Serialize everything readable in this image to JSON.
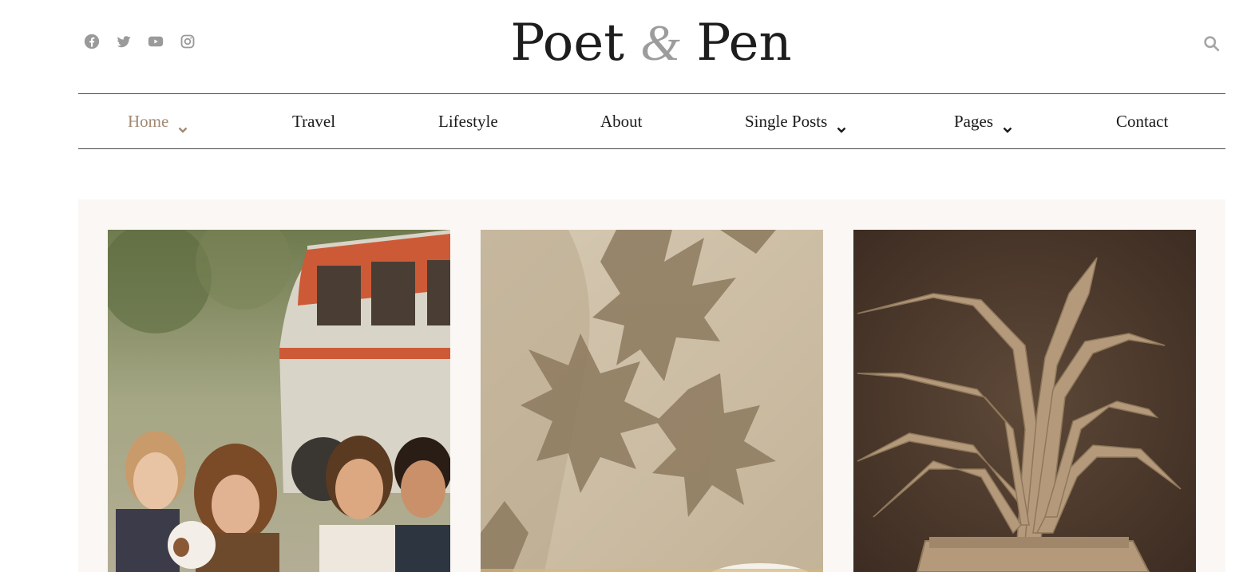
{
  "header": {
    "logo": {
      "part1": "Poet ",
      "amp": "&",
      "part2": " Pen"
    },
    "social": [
      "facebook-icon",
      "twitter-icon",
      "youtube-icon",
      "instagram-icon"
    ],
    "search_icon": "search-icon"
  },
  "nav": {
    "items": [
      {
        "label": "Home",
        "dropdown": true,
        "active": true
      },
      {
        "label": "Travel",
        "dropdown": false
      },
      {
        "label": "Lifestyle",
        "dropdown": false
      },
      {
        "label": "About",
        "dropdown": false
      },
      {
        "label": "Single Posts",
        "dropdown": true
      },
      {
        "label": "Pages",
        "dropdown": true
      },
      {
        "label": "Contact",
        "dropdown": false
      }
    ]
  },
  "colors": {
    "accent": "#a18a73",
    "panel_bg": "#faf7f5",
    "icon_gray": "#9a9a9a"
  },
  "cards": [
    {
      "image": "friends-with-dog-and-van-photo"
    },
    {
      "image": "leaf-shadow-on-wall-photo"
    },
    {
      "image": "cardboard-plant-sculpture-photo"
    }
  ]
}
